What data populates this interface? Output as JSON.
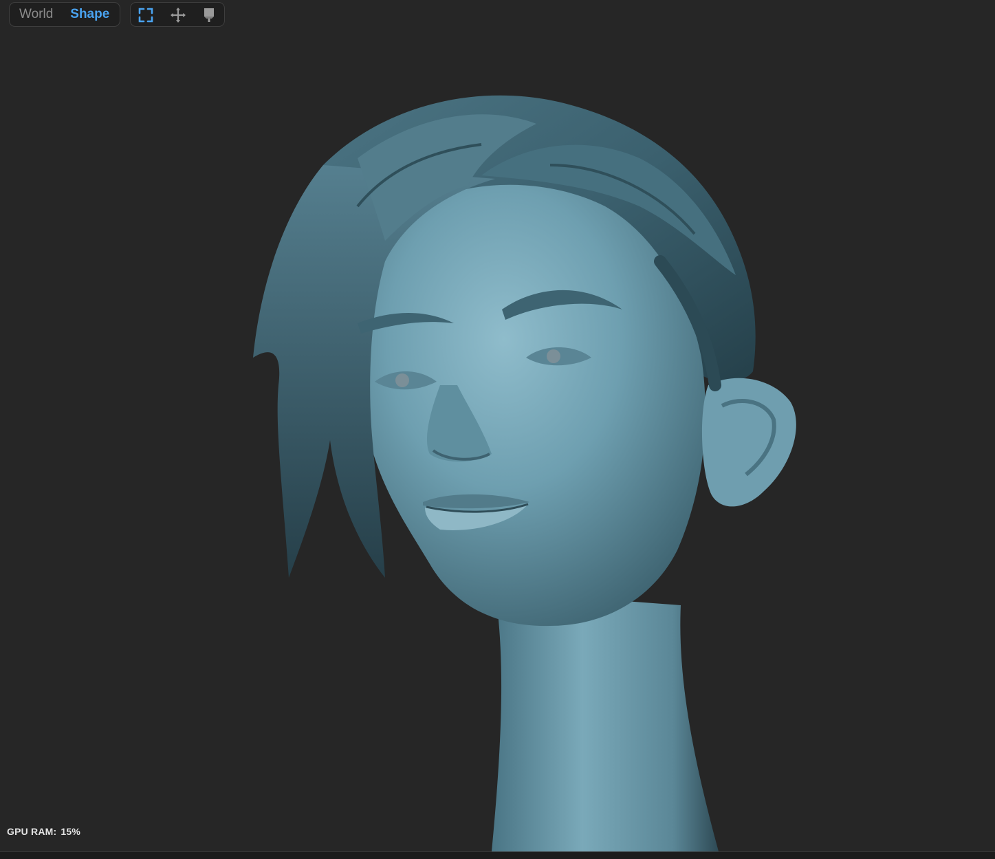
{
  "toolbar": {
    "space_toggle": {
      "world_label": "World",
      "shape_label": "Shape",
      "active": "Shape"
    },
    "tools": [
      {
        "icon": "frame-select-icon",
        "active": true
      },
      {
        "icon": "move-icon",
        "active": false
      },
      {
        "icon": "paint-brush-icon",
        "active": false
      }
    ]
  },
  "status": {
    "gpu_label": "GPU RAM:",
    "gpu_value": "15%"
  },
  "colors": {
    "background": "#262626",
    "accent": "#4aa3f0",
    "model_skin": "#6c9bab",
    "model_hair": "#3b6270"
  }
}
